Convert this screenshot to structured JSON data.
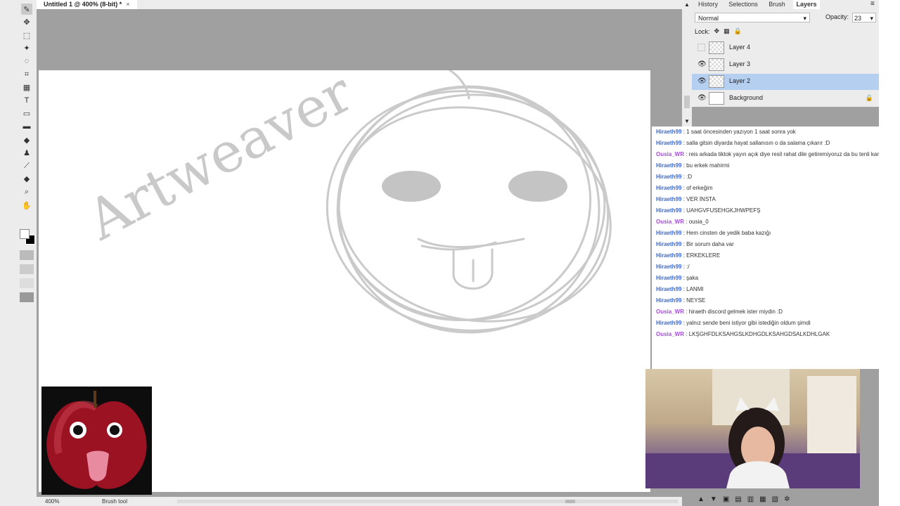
{
  "document": {
    "tab_title": "Untitled 1 @ 400% (8-bit) *",
    "close_glyph": "×"
  },
  "tools": [
    {
      "name": "brush-tool-icon",
      "glyph": "✎",
      "active": true
    },
    {
      "name": "move-tool-icon",
      "glyph": "✥"
    },
    {
      "name": "marquee-tool-icon",
      "glyph": "⬚"
    },
    {
      "name": "magic-wand-tool-icon",
      "glyph": "✦"
    },
    {
      "name": "lasso-tool-icon",
      "glyph": "◌"
    },
    {
      "name": "crop-tool-icon",
      "glyph": "⌗"
    },
    {
      "name": "grid-tool-icon",
      "glyph": "▦"
    },
    {
      "name": "text-tool-icon",
      "glyph": "T"
    },
    {
      "name": "shape-tool-icon",
      "glyph": "▭"
    },
    {
      "name": "gradient-tool-icon",
      "glyph": "▬"
    },
    {
      "name": "eraser-tool-icon",
      "glyph": "◆"
    },
    {
      "name": "clone-stamp-tool-icon",
      "glyph": "♟"
    },
    {
      "name": "eyedropper-tool-icon",
      "glyph": "⟋"
    },
    {
      "name": "fill-tool-icon",
      "glyph": "◆"
    },
    {
      "name": "zoom-tool-icon",
      "glyph": "⌕"
    },
    {
      "name": "hand-tool-icon",
      "glyph": "✋"
    }
  ],
  "canvas": {
    "signature_text": "Artweaver"
  },
  "status": {
    "zoom": "400%",
    "tool": "Brush tool"
  },
  "panel": {
    "tabs": [
      "History",
      "Selections",
      "Brush",
      "Layers"
    ],
    "active_tab": "Layers",
    "blend_mode": "Normal",
    "opacity_label": "Opacity:",
    "opacity_value": "23",
    "lock_label": "Lock:",
    "layers": [
      {
        "name": "Layer 4",
        "visible": false,
        "selected": false,
        "locked": false
      },
      {
        "name": "Layer 3",
        "visible": true,
        "selected": false,
        "locked": false
      },
      {
        "name": "Layer 2",
        "visible": true,
        "selected": true,
        "locked": false
      },
      {
        "name": "Background",
        "visible": true,
        "selected": false,
        "locked": true
      }
    ]
  },
  "chat": [
    {
      "user": "Hiraeth99",
      "text": ": 1 saat öncesinden yazıyon 1 saat sonra yok",
      "color": "blue"
    },
    {
      "user": "Hiraeth99",
      "text": ": salla gitsin diyarda hayat sallanısın o da salama çıkarır :D",
      "color": "blue"
    },
    {
      "user": "Ousia_WR",
      "text": ": reis arkada tiktok yayın açık diye resil rahat dile getiremiyoruz da bu tenli kararsız bi insan varsa sıktir et daha geç ayrılma ihtimalin daha kötü",
      "color": "purple"
    },
    {
      "user": "Hiraeth99",
      "text": ": bu erkek mahirmi",
      "color": "blue"
    },
    {
      "user": "Hiraeth99",
      "text": ": :D",
      "color": "blue"
    },
    {
      "user": "Hiraeth99",
      "text": ": of erkeğim",
      "color": "blue"
    },
    {
      "user": "Hiraeth99",
      "text": ": VER İNSTA",
      "color": "blue"
    },
    {
      "user": "Hiraeth99",
      "text": ": UAHGVFUSEHGKJHWPEFŞ",
      "color": "blue"
    },
    {
      "user": "Ousia_WR",
      "text": ": ousia_0",
      "color": "purple"
    },
    {
      "user": "Hiraeth99",
      "text": ": Hem cinsten de yedik baba kazığı",
      "color": "blue"
    },
    {
      "user": "Hiraeth99",
      "text": ": Bir sorum daha var",
      "color": "blue"
    },
    {
      "user": "Hiraeth99",
      "text": ": ERKEKLERE",
      "color": "blue"
    },
    {
      "user": "Hiraeth99",
      "text": ": :/",
      "color": "blue"
    },
    {
      "user": "Hiraeth99",
      "text": ": şaka",
      "color": "blue"
    },
    {
      "user": "Hiraeth99",
      "text": ": LANMI",
      "color": "blue"
    },
    {
      "user": "Hiraeth99",
      "text": ": NEYSE",
      "color": "blue"
    },
    {
      "user": "Ousia_WR",
      "text": ": hiraeth discord gelmek ister miydin :D",
      "color": "purple"
    },
    {
      "user": "Hiraeth99",
      "text": ": yalnız sende beni istiyor gibi istediğin oldum şimdi",
      "color": "blue"
    },
    {
      "user": "Ousia_WR",
      "text": ": LKŞGHFDLKSAHGSLKDHGDLKSAHGDSALKDHLGAK",
      "color": "purple"
    }
  ],
  "colors": {
    "workspace": "#a0a0a0",
    "panel_bg": "#ececec",
    "selected_layer": "#b5cff1",
    "chat_user_blue": "#3b6ad6",
    "chat_user_purple": "#a34fd6"
  }
}
